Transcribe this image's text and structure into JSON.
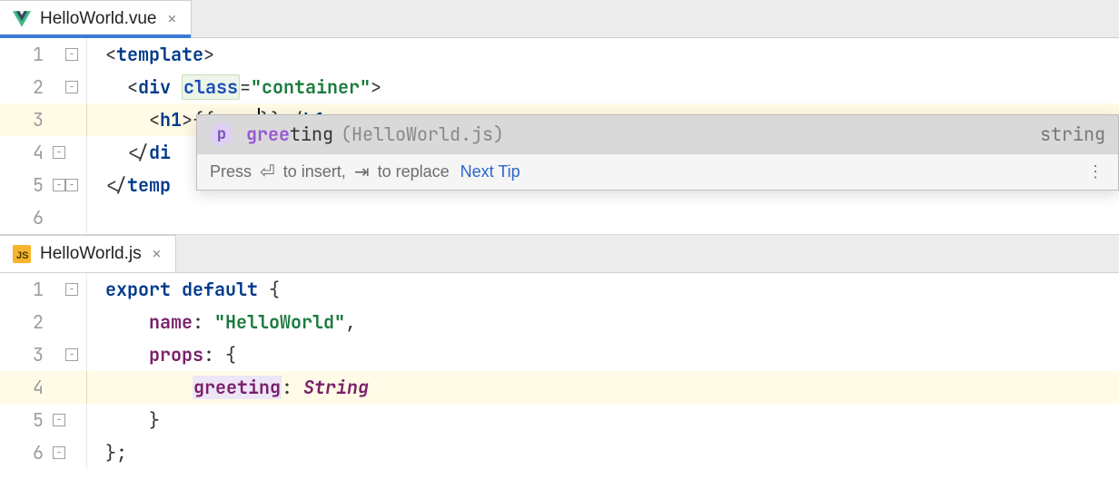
{
  "panes": {
    "top": {
      "tab": {
        "filename": "HelloWorld.vue",
        "closable": true,
        "active": true
      },
      "lines": [
        {
          "n": "1",
          "fold": "open",
          "tokens": [
            {
              "c": "p",
              "t": "<"
            },
            {
              "c": "tag",
              "t": "template"
            },
            {
              "c": "p",
              "t": ">"
            }
          ]
        },
        {
          "n": "2",
          "fold": "open",
          "tokens": [
            {
              "c": "p",
              "t": "  <"
            },
            {
              "c": "tag",
              "t": "div"
            },
            {
              "c": "p",
              "t": " "
            },
            {
              "c": "attr box",
              "t": "class"
            },
            {
              "c": "p",
              "t": "="
            },
            {
              "c": "str",
              "t": "\"container\""
            },
            {
              "c": "p",
              "t": ">"
            }
          ]
        },
        {
          "n": "3",
          "hl": true,
          "tokens": [
            {
              "c": "p",
              "t": "    <"
            },
            {
              "c": "tag",
              "t": "h1"
            },
            {
              "c": "p",
              "t": ">"
            },
            {
              "c": "p",
              "t": "{{gree"
            },
            {
              "caret": true
            },
            {
              "c": "p",
              "t": "}}"
            },
            {
              "c": "p",
              "t": "</"
            },
            {
              "c": "tag",
              "t": "h1"
            },
            {
              "c": "p",
              "t": ">"
            }
          ]
        },
        {
          "n": "4",
          "fold": "close",
          "tokens": [
            {
              "c": "p",
              "t": "  </"
            },
            {
              "c": "tag",
              "t": "di"
            }
          ]
        },
        {
          "n": "5",
          "fold": "close-both",
          "tokens": [
            {
              "c": "p",
              "t": "</"
            },
            {
              "c": "tag",
              "t": "temp"
            }
          ]
        },
        {
          "n": "6",
          "tokens": []
        }
      ]
    },
    "bottom": {
      "tab": {
        "filename": "HelloWorld.js",
        "closable": true,
        "active": false
      },
      "lines": [
        {
          "n": "1",
          "fold": "open",
          "tokens": [
            {
              "c": "kw",
              "t": "export default"
            },
            {
              "c": "p",
              "t": " {"
            }
          ]
        },
        {
          "n": "2",
          "tokens": [
            {
              "c": "p",
              "t": "    "
            },
            {
              "c": "kw2",
              "t": "name"
            },
            {
              "c": "p",
              "t": ": "
            },
            {
              "c": "str",
              "t": "\"HelloWorld\""
            },
            {
              "c": "p",
              "t": ","
            }
          ]
        },
        {
          "n": "3",
          "fold": "open",
          "tokens": [
            {
              "c": "p",
              "t": "    "
            },
            {
              "c": "kw2",
              "t": "props"
            },
            {
              "c": "p",
              "t": ": {"
            }
          ]
        },
        {
          "n": "4",
          "hl": true,
          "tokens": [
            {
              "c": "p",
              "t": "        "
            },
            {
              "c": "kw2 box2",
              "t": "greeting"
            },
            {
              "c": "p",
              "t": ": "
            },
            {
              "c": "type",
              "t": "String"
            }
          ]
        },
        {
          "n": "5",
          "fold": "close",
          "tokens": [
            {
              "c": "p",
              "t": "    }"
            }
          ]
        },
        {
          "n": "6",
          "fold": "close",
          "tokens": [
            {
              "c": "p",
              "t": "};"
            }
          ]
        }
      ]
    }
  },
  "autocomplete": {
    "kind_letter": "p",
    "name_match": "gree",
    "name_rest": "ting",
    "source_hint": "(HelloWorld.js)",
    "right_type": "string",
    "footer_pre": "Press",
    "footer_insert": "to insert,",
    "footer_replace": "to replace",
    "next_tip": "Next Tip"
  }
}
